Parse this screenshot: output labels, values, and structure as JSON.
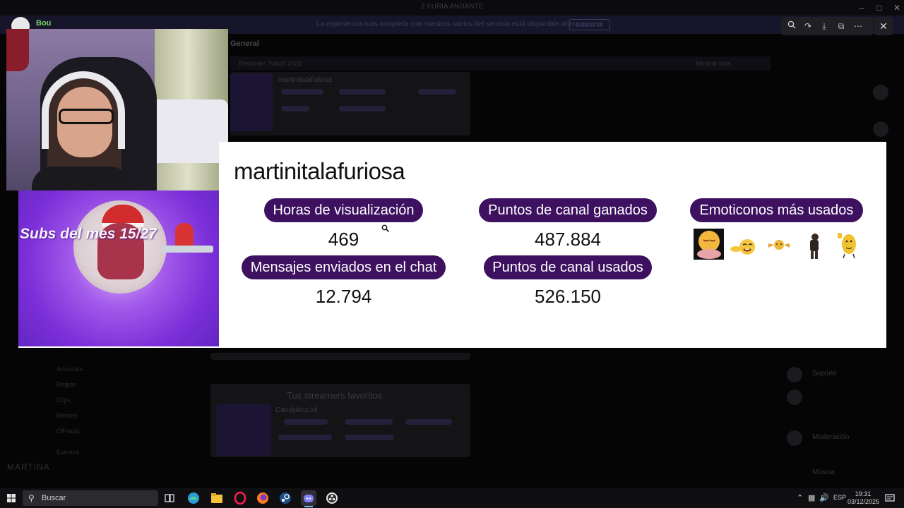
{
  "background_app": {
    "title": "Z FURIA ANDANTE",
    "banner_text": "La experiencia más completa con nuestros socios del servicio está disponible ahora mismo",
    "banner_button": "Descubrir",
    "channel_label": "General",
    "strip_left": "Resumen Twitch 2025",
    "strip_right": "Mostrar más",
    "card1": {
      "title": "martinitalafuriosa"
    },
    "card2": {
      "heading": "Tus streamers favoritos",
      "title": "Candykinz.lol"
    },
    "sidebar_items": [
      "Anuncios",
      "Reglas",
      "Clips",
      "Memes",
      "Off-topic",
      "Eventos"
    ],
    "right_items": [
      "Soporte",
      "Moderación",
      "Música"
    ],
    "footer_user": "MARTINA"
  },
  "viewer": {
    "toolbar_icons": [
      "zoom-in-icon",
      "share-icon",
      "download-icon",
      "open-external-icon",
      "more-icon"
    ],
    "close_icon": "close-icon"
  },
  "stream_overlay": {
    "user_name": "Bou",
    "subs_text": "Subs del mes 15/27"
  },
  "stats": {
    "username": "martinitalafuriosa",
    "watch_hours_label": "Horas de visualización",
    "watch_hours_value": "469",
    "channel_points_earned_label": "Puntos de canal ganados",
    "channel_points_earned_value": "487.884",
    "most_used_emotes_label": "Emoticonos más usados",
    "messages_sent_label": "Mensajes enviados en el chat",
    "messages_sent_value": "12.794",
    "channel_points_used_label": "Puntos de canal usados",
    "channel_points_used_value": "526.150",
    "emotes": [
      "blushing-face-emote",
      "laughing-emote",
      "hugging-emote",
      "bowing-man-emote",
      "thumbs-up-emote"
    ]
  },
  "taskbar": {
    "search_placeholder": "Buscar",
    "apps": [
      "task-view-icon",
      "edge-icon",
      "file-explorer-icon",
      "opera-gx-icon",
      "firefox-icon",
      "steam-icon",
      "discord-icon",
      "obs-icon"
    ],
    "language": "ESP",
    "time": "19:31",
    "date": "03/12/2025"
  },
  "colors": {
    "pill_bg": "#3d1160",
    "card_bg": "#ffffff",
    "subs_purple": "#7b2fd8",
    "username_green": "#7ad36b"
  }
}
